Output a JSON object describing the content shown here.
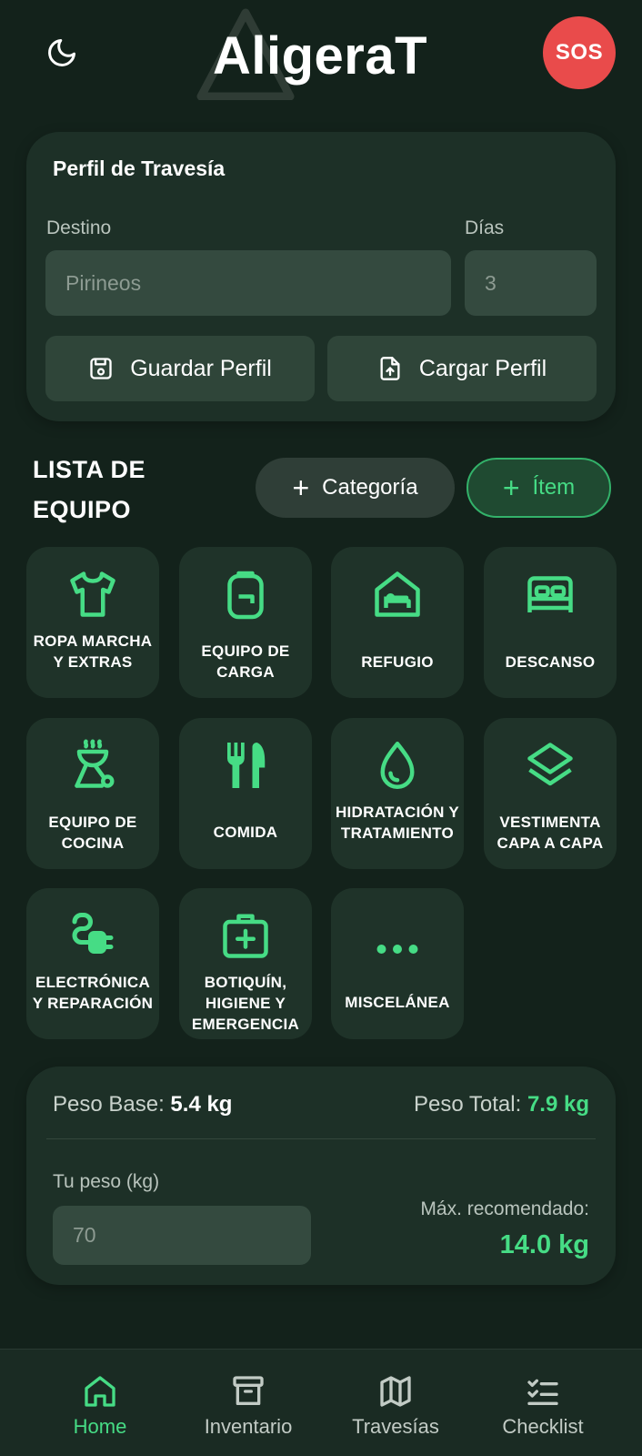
{
  "header": {
    "title": "AligeraT",
    "sos_label": "SOS",
    "theme_icon": "moon-icon"
  },
  "profile": {
    "title": "Perfil de Travesía",
    "destination_label": "Destino",
    "destination_placeholder": "Pirineos",
    "days_label": "Días",
    "days_placeholder": "3",
    "save_label": "Guardar Perfil",
    "load_label": "Cargar Perfil"
  },
  "gear": {
    "title_line1": "LISTA DE",
    "title_line2": "EQUIPO",
    "add_category_label": "Categoría",
    "add_item_label": "Ítem",
    "categories": [
      {
        "label": "ROPA MARCHA Y EXTRAS",
        "icon": "shirt-icon"
      },
      {
        "label": "EQUIPO DE CARGA",
        "icon": "backpack-icon"
      },
      {
        "label": "REFUGIO",
        "icon": "shelter-icon"
      },
      {
        "label": "DESCANSO",
        "icon": "bed-icon"
      },
      {
        "label": "EQUIPO DE COCINA",
        "icon": "grill-icon"
      },
      {
        "label": "COMIDA",
        "icon": "utensils-icon"
      },
      {
        "label": "HIDRATACIÓN Y TRATAMIENTO",
        "icon": "water-drop-icon"
      },
      {
        "label": "VESTIMENTA CAPA A CAPA",
        "icon": "layers-icon"
      },
      {
        "label": "ELECTRÓNICA Y REPARACIÓN",
        "icon": "plug-icon"
      },
      {
        "label": "BOTIQUÍN, HIGIENE Y EMERGENCIA",
        "icon": "first-aid-icon"
      },
      {
        "label": "MISCELÁNEA",
        "icon": "more-dots-icon"
      }
    ]
  },
  "weights": {
    "base_label": "Peso Base:",
    "base_value": "5.4 kg",
    "total_label": "Peso Total:",
    "total_value": "7.9 kg",
    "your_weight_label": "Tu peso (kg)",
    "your_weight_placeholder": "70",
    "max_label": "Máx. recomendado:",
    "max_value": "14.0 kg"
  },
  "nav": [
    {
      "label": "Home",
      "icon": "home-icon",
      "active": true
    },
    {
      "label": "Inventario",
      "icon": "archive-icon",
      "active": false
    },
    {
      "label": "Travesías",
      "icon": "map-icon",
      "active": false
    },
    {
      "label": "Checklist",
      "icon": "checklist-icon",
      "active": false
    }
  ],
  "colors": {
    "background": "#13221b",
    "card": "#1d3027",
    "accent": "#46dc85",
    "sos": "#e94b4b"
  }
}
